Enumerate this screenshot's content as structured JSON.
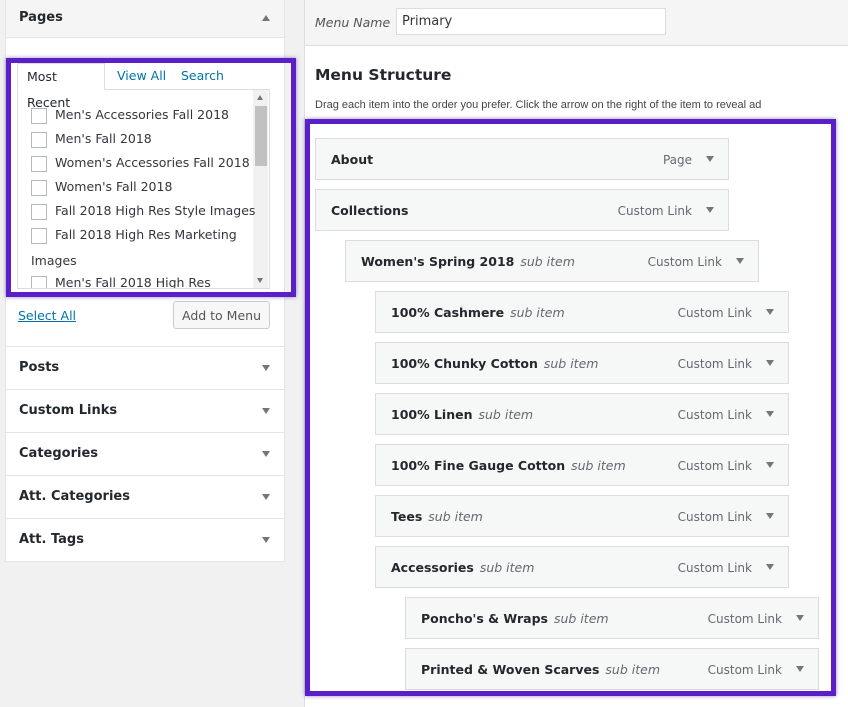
{
  "left": {
    "pages_title": "Pages",
    "tabs": [
      "Most Recent",
      "View All",
      "Search"
    ],
    "pages": [
      "Men's Accessories Fall 2018",
      "Men's Fall 2018",
      "Women's Accessories Fall 2018",
      "Women's Fall 2018",
      "Fall 2018 High Res Style Images",
      "Fall 2018 High Res Marketing"
    ],
    "wrap_text": "Images",
    "last_page": "Men's Fall 2018 High Res",
    "select_all": "Select All",
    "add_to_menu": "Add to Menu",
    "sections": [
      "Posts",
      "Custom Links",
      "Categories",
      "Att. Categories",
      "Att. Tags"
    ]
  },
  "menu": {
    "name_label": "Menu Name",
    "name_value": "Primary",
    "structure_title": "Menu Structure",
    "description": "Drag each item into the order you prefer. Click the arrow on the right of the item to reveal ad",
    "sub_label": "sub item",
    "items": [
      {
        "title": "About",
        "type": "Page",
        "depth": 0
      },
      {
        "title": "Collections",
        "type": "Custom Link",
        "depth": 0
      },
      {
        "title": "Women's  Spring 2018",
        "type": "Custom Link",
        "depth": 1
      },
      {
        "title": "100% Cashmere",
        "type": "Custom Link",
        "depth": 2
      },
      {
        "title": "100% Chunky Cotton",
        "type": "Custom Link",
        "depth": 2
      },
      {
        "title": "100% Linen",
        "type": "Custom Link",
        "depth": 2
      },
      {
        "title": "100% Fine Gauge Cotton",
        "type": "Custom Link",
        "depth": 2
      },
      {
        "title": "Tees",
        "type": "Custom Link",
        "depth": 2
      },
      {
        "title": "Accessories",
        "type": "Custom Link",
        "depth": 2
      },
      {
        "title": "Poncho's & Wraps",
        "type": "Custom Link",
        "depth": 3
      },
      {
        "title": "Printed & Woven Scarves",
        "type": "Custom Link",
        "depth": 3
      }
    ]
  },
  "colors": {
    "highlight": "#5b1fc8",
    "link": "#0073aa"
  }
}
